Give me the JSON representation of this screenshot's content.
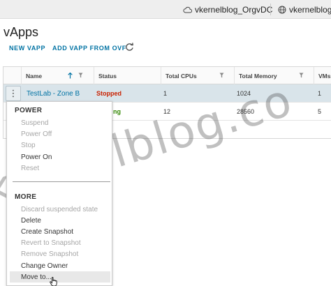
{
  "topbar": {
    "org_label": "vkernelblog_OrgvDC",
    "site_label": "vkernelblog."
  },
  "page": {
    "title": "vApps"
  },
  "actions": {
    "new_vapp": "NEW VAPP",
    "add_from_ovf": "ADD VAPP FROM OVF"
  },
  "grid": {
    "columns": {
      "name": "Name",
      "status": "Status",
      "cpus": "Total CPUs",
      "memory": "Total Memory",
      "vms": "VMs"
    },
    "rows": [
      {
        "name": "TestLab - Zone B",
        "status": "Stopped",
        "cpus": "1",
        "memory": "1024",
        "vms": "1"
      },
      {
        "name": "",
        "status": "ng",
        "cpus": "12",
        "memory": "28560",
        "vms": "5"
      }
    ]
  },
  "menu": {
    "power_header": "POWER",
    "power_items": [
      {
        "label": "Suspend",
        "enabled": false
      },
      {
        "label": "Power Off",
        "enabled": false
      },
      {
        "label": "Stop",
        "enabled": false
      },
      {
        "label": "Power On",
        "enabled": true
      },
      {
        "label": "Reset",
        "enabled": false
      }
    ],
    "more_header": "MORE",
    "more_items": [
      {
        "label": "Discard suspended state",
        "enabled": false
      },
      {
        "label": "Delete",
        "enabled": true
      },
      {
        "label": "Create Snapshot",
        "enabled": true
      },
      {
        "label": "Revert to Snapshot",
        "enabled": false
      },
      {
        "label": "Remove Snapshot",
        "enabled": false
      },
      {
        "label": "Change Owner",
        "enabled": true
      },
      {
        "label": "Move to...",
        "enabled": true
      }
    ]
  },
  "watermark": {
    "text": "kernelblog.co"
  },
  "colors": {
    "link": "#0072a3",
    "stopped": "#c92100",
    "running": "#318700",
    "selected_row": "#d9e4ea"
  }
}
